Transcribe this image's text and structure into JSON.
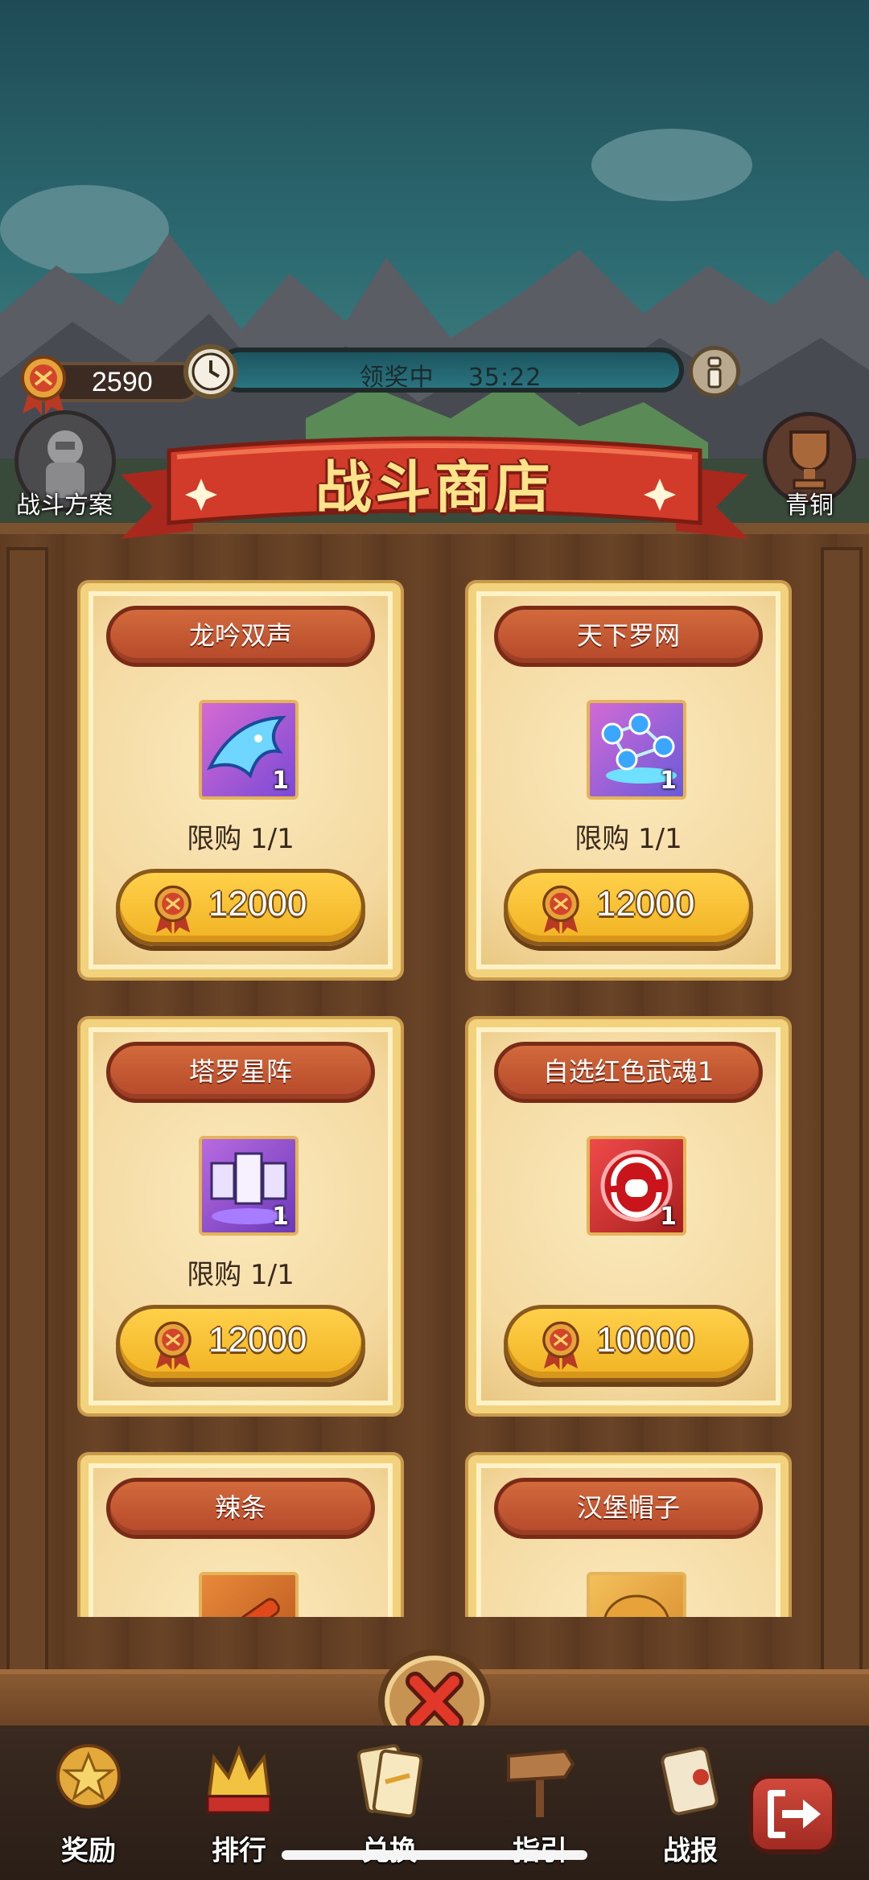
{
  "hud": {
    "currency_value": "2590",
    "timer_label": "领奖中",
    "timer_value": "35:22",
    "side_avatar_label": "战斗方案",
    "rank_label": "青铜"
  },
  "banner": {
    "title": "战斗商店"
  },
  "shop": {
    "items": [
      {
        "name": "龙吟双声",
        "count": "1",
        "limit": "限购 1/1",
        "price": "12000",
        "icon": "blue-dragon-icon"
      },
      {
        "name": "天下罗网",
        "count": "1",
        "limit": "限购 1/1",
        "price": "12000",
        "icon": "net-stars-icon"
      },
      {
        "name": "塔罗星阵",
        "count": "1",
        "limit": "限购 1/1",
        "price": "12000",
        "icon": "tarot-cards-icon"
      },
      {
        "name": "自选红色武魂1",
        "count": "1",
        "limit": "",
        "price": "10000",
        "icon": "red-soul-icon"
      },
      {
        "name": "辣条",
        "icon": "spicy-strip-icon"
      },
      {
        "name": "汉堡帽子",
        "icon": "burger-hat-icon"
      }
    ]
  },
  "nav": {
    "items": [
      {
        "label": "奖励",
        "icon": "star-medal-icon"
      },
      {
        "label": "排行",
        "icon": "crown-icon"
      },
      {
        "label": "兑换",
        "icon": "ticket-icon"
      },
      {
        "label": "指引",
        "icon": "signpost-icon"
      },
      {
        "label": "战报",
        "icon": "scroll-icon"
      }
    ],
    "exit_icon": "exit-icon"
  },
  "colors": {
    "gold_button": "#f0b323",
    "title_red": "#b5482a",
    "banner_text": "#ffe38a",
    "wood": "#5e3b22"
  }
}
